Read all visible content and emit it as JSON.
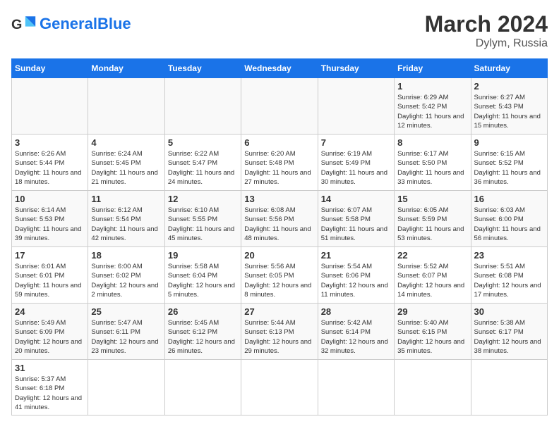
{
  "header": {
    "logo_general": "General",
    "logo_blue": "Blue",
    "month_year": "March 2024",
    "location": "Dylym, Russia"
  },
  "weekdays": [
    "Sunday",
    "Monday",
    "Tuesday",
    "Wednesday",
    "Thursday",
    "Friday",
    "Saturday"
  ],
  "weeks": [
    [
      {
        "day": "",
        "info": ""
      },
      {
        "day": "",
        "info": ""
      },
      {
        "day": "",
        "info": ""
      },
      {
        "day": "",
        "info": ""
      },
      {
        "day": "",
        "info": ""
      },
      {
        "day": "1",
        "info": "Sunrise: 6:29 AM\nSunset: 5:42 PM\nDaylight: 11 hours and 12 minutes."
      },
      {
        "day": "2",
        "info": "Sunrise: 6:27 AM\nSunset: 5:43 PM\nDaylight: 11 hours and 15 minutes."
      }
    ],
    [
      {
        "day": "3",
        "info": "Sunrise: 6:26 AM\nSunset: 5:44 PM\nDaylight: 11 hours and 18 minutes."
      },
      {
        "day": "4",
        "info": "Sunrise: 6:24 AM\nSunset: 5:45 PM\nDaylight: 11 hours and 21 minutes."
      },
      {
        "day": "5",
        "info": "Sunrise: 6:22 AM\nSunset: 5:47 PM\nDaylight: 11 hours and 24 minutes."
      },
      {
        "day": "6",
        "info": "Sunrise: 6:20 AM\nSunset: 5:48 PM\nDaylight: 11 hours and 27 minutes."
      },
      {
        "day": "7",
        "info": "Sunrise: 6:19 AM\nSunset: 5:49 PM\nDaylight: 11 hours and 30 minutes."
      },
      {
        "day": "8",
        "info": "Sunrise: 6:17 AM\nSunset: 5:50 PM\nDaylight: 11 hours and 33 minutes."
      },
      {
        "day": "9",
        "info": "Sunrise: 6:15 AM\nSunset: 5:52 PM\nDaylight: 11 hours and 36 minutes."
      }
    ],
    [
      {
        "day": "10",
        "info": "Sunrise: 6:14 AM\nSunset: 5:53 PM\nDaylight: 11 hours and 39 minutes."
      },
      {
        "day": "11",
        "info": "Sunrise: 6:12 AM\nSunset: 5:54 PM\nDaylight: 11 hours and 42 minutes."
      },
      {
        "day": "12",
        "info": "Sunrise: 6:10 AM\nSunset: 5:55 PM\nDaylight: 11 hours and 45 minutes."
      },
      {
        "day": "13",
        "info": "Sunrise: 6:08 AM\nSunset: 5:56 PM\nDaylight: 11 hours and 48 minutes."
      },
      {
        "day": "14",
        "info": "Sunrise: 6:07 AM\nSunset: 5:58 PM\nDaylight: 11 hours and 51 minutes."
      },
      {
        "day": "15",
        "info": "Sunrise: 6:05 AM\nSunset: 5:59 PM\nDaylight: 11 hours and 53 minutes."
      },
      {
        "day": "16",
        "info": "Sunrise: 6:03 AM\nSunset: 6:00 PM\nDaylight: 11 hours and 56 minutes."
      }
    ],
    [
      {
        "day": "17",
        "info": "Sunrise: 6:01 AM\nSunset: 6:01 PM\nDaylight: 11 hours and 59 minutes."
      },
      {
        "day": "18",
        "info": "Sunrise: 6:00 AM\nSunset: 6:02 PM\nDaylight: 12 hours and 2 minutes."
      },
      {
        "day": "19",
        "info": "Sunrise: 5:58 AM\nSunset: 6:04 PM\nDaylight: 12 hours and 5 minutes."
      },
      {
        "day": "20",
        "info": "Sunrise: 5:56 AM\nSunset: 6:05 PM\nDaylight: 12 hours and 8 minutes."
      },
      {
        "day": "21",
        "info": "Sunrise: 5:54 AM\nSunset: 6:06 PM\nDaylight: 12 hours and 11 minutes."
      },
      {
        "day": "22",
        "info": "Sunrise: 5:52 AM\nSunset: 6:07 PM\nDaylight: 12 hours and 14 minutes."
      },
      {
        "day": "23",
        "info": "Sunrise: 5:51 AM\nSunset: 6:08 PM\nDaylight: 12 hours and 17 minutes."
      }
    ],
    [
      {
        "day": "24",
        "info": "Sunrise: 5:49 AM\nSunset: 6:09 PM\nDaylight: 12 hours and 20 minutes."
      },
      {
        "day": "25",
        "info": "Sunrise: 5:47 AM\nSunset: 6:11 PM\nDaylight: 12 hours and 23 minutes."
      },
      {
        "day": "26",
        "info": "Sunrise: 5:45 AM\nSunset: 6:12 PM\nDaylight: 12 hours and 26 minutes."
      },
      {
        "day": "27",
        "info": "Sunrise: 5:44 AM\nSunset: 6:13 PM\nDaylight: 12 hours and 29 minutes."
      },
      {
        "day": "28",
        "info": "Sunrise: 5:42 AM\nSunset: 6:14 PM\nDaylight: 12 hours and 32 minutes."
      },
      {
        "day": "29",
        "info": "Sunrise: 5:40 AM\nSunset: 6:15 PM\nDaylight: 12 hours and 35 minutes."
      },
      {
        "day": "30",
        "info": "Sunrise: 5:38 AM\nSunset: 6:17 PM\nDaylight: 12 hours and 38 minutes."
      }
    ],
    [
      {
        "day": "31",
        "info": "Sunrise: 5:37 AM\nSunset: 6:18 PM\nDaylight: 12 hours and 41 minutes."
      },
      {
        "day": "",
        "info": ""
      },
      {
        "day": "",
        "info": ""
      },
      {
        "day": "",
        "info": ""
      },
      {
        "day": "",
        "info": ""
      },
      {
        "day": "",
        "info": ""
      },
      {
        "day": "",
        "info": ""
      }
    ]
  ]
}
